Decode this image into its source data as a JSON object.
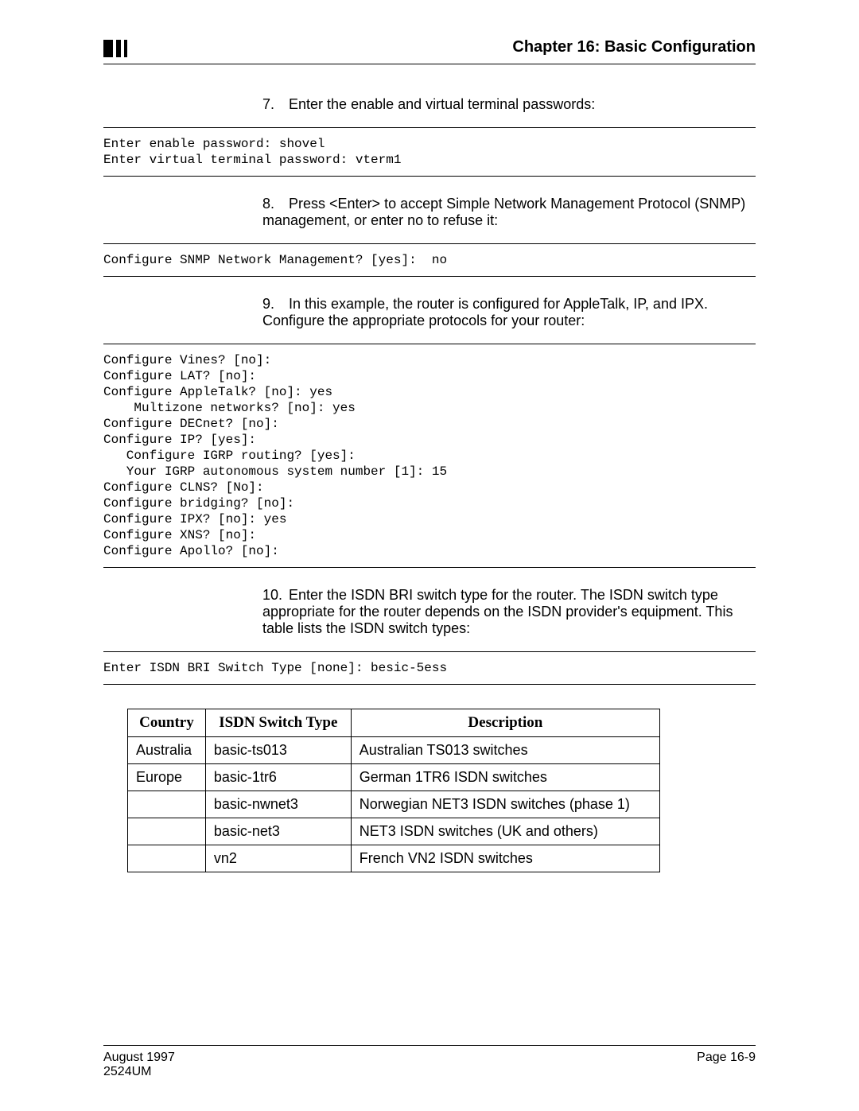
{
  "header": {
    "chapter": "Chapter 16: Basic Configuration"
  },
  "steps": {
    "s7": {
      "num": "7.",
      "text": "Enter the enable and virtual terminal passwords:"
    },
    "s8": {
      "num": "8.",
      "text": "Press <Enter> to accept Simple Network Management Protocol (SNMP) management, or enter no to refuse it:"
    },
    "s9": {
      "num": "9.",
      "text": "In this example, the router is configured for AppleTalk, IP, and IPX. Configure the appropriate protocols for your router:"
    },
    "s10": {
      "num": "10.",
      "text": "Enter the ISDN BRI switch type for the router. The ISDN switch type appropriate for the router depends on the ISDN provider's equipment. This table lists the ISDN switch types:"
    }
  },
  "terminal": {
    "t1": "Enter enable password: shovel\nEnter virtual terminal password: vterm1",
    "t2": "Configure SNMP Network Management? [yes]:  no",
    "t3": "Configure Vines? [no]:\nConfigure LAT? [no]:\nConfigure AppleTalk? [no]: yes\n    Multizone networks? [no]: yes\nConfigure DECnet? [no]:\nConfigure IP? [yes]:\n   Configure IGRP routing? [yes]:\n   Your IGRP autonomous system number [1]: 15\nConfigure CLNS? [No]:\nConfigure bridging? [no]:\nConfigure IPX? [no]: yes\nConfigure XNS? [no]:\nConfigure Apollo? [no]:",
    "t4": "Enter ISDN BRI Switch Type [none]: besic-5ess"
  },
  "table": {
    "headers": {
      "c1": "Country",
      "c2": "ISDN Switch Type",
      "c3": "Description"
    },
    "rows": [
      {
        "c1": "Australia",
        "c2": "basic-ts013",
        "c3": "Australian TS013 switches"
      },
      {
        "c1": "Europe",
        "c2": "basic-1tr6",
        "c3": "German 1TR6 ISDN switches"
      },
      {
        "c1": "",
        "c2": "basic-nwnet3",
        "c3": "Norwegian NET3 ISDN switches (phase 1)"
      },
      {
        "c1": "",
        "c2": "basic-net3",
        "c3": "NET3 ISDN switches (UK and others)"
      },
      {
        "c1": "",
        "c2": "vn2",
        "c3": "French VN2 ISDN switches"
      }
    ]
  },
  "footer": {
    "date": "August 1997",
    "doc": "2524UM",
    "page": "Page 16-9"
  }
}
